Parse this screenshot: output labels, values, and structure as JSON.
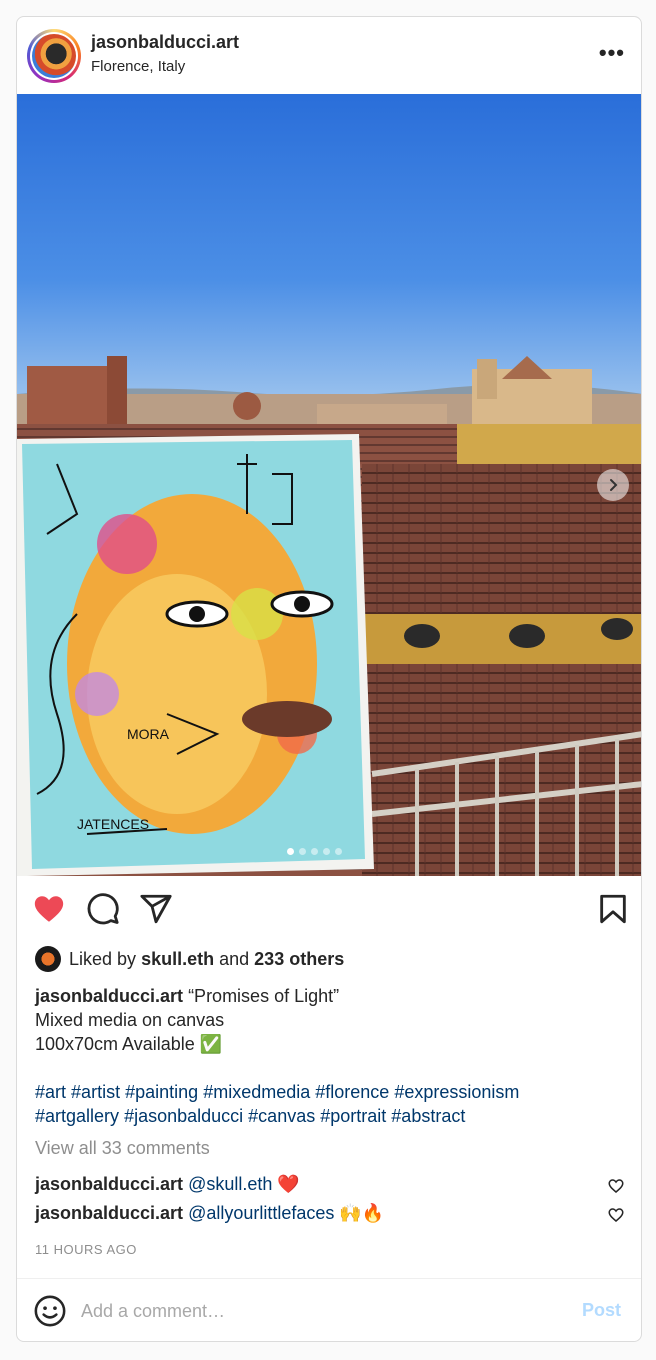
{
  "post": {
    "username": "jasonbalducci.art",
    "location": "Florence, Italy",
    "more_icon": "more-horizontal-icon"
  },
  "carousel": {
    "slide_count": 5,
    "active_slide": 1,
    "next_icon": "chevron-right-icon"
  },
  "actions": {
    "liked": true,
    "like_color": "#ed4956",
    "icons": [
      "heart-icon",
      "comment-icon",
      "share-icon",
      "bookmark-icon"
    ]
  },
  "likes": {
    "prefix": "Liked by ",
    "user": "skull.eth",
    "middle": " and ",
    "others": "233 others"
  },
  "caption": {
    "user": "jasonbalducci.art",
    "line1": "“Promises of Light”",
    "line2": "Mixed media on canvas",
    "line3": "100x70cm Available ✅",
    "hashtags_line1": [
      "#art",
      "#artist",
      "#painting",
      "#mixedmedia",
      "#florence",
      "#expressionism"
    ],
    "hashtags_line2": [
      "#artgallery",
      "#jasonbalducci",
      "#canvas",
      "#portrait",
      "#abstract"
    ]
  },
  "view_all_comments": "View all 33 comments",
  "comments": [
    {
      "user": "jasonbalducci.art",
      "mention": "@skull.eth",
      "emoji": "❤️"
    },
    {
      "user": "jasonbalducci.art",
      "mention": "@allyourlittlefaces",
      "emoji": "🙌🔥"
    }
  ],
  "timestamp": "11 HOURS AGO",
  "add_comment": {
    "placeholder": "Add a comment…",
    "post_label": "Post",
    "post_color": "#b3dbff"
  }
}
